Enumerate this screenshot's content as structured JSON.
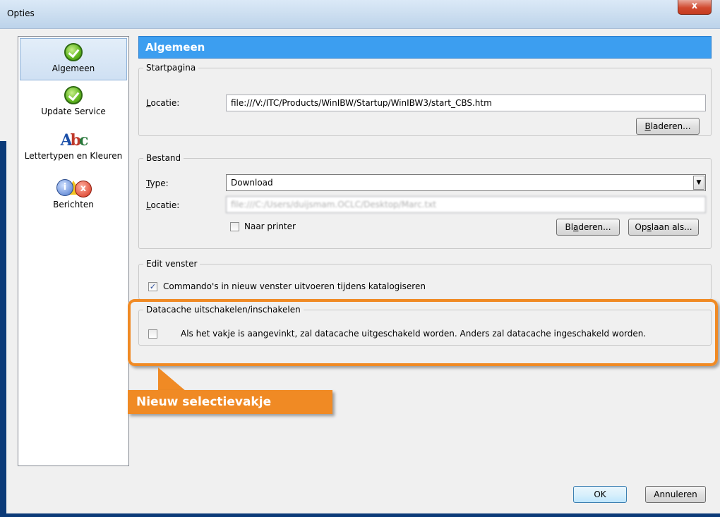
{
  "window": {
    "title": "Opties",
    "close_glyph": "x"
  },
  "sidebar": {
    "items": [
      {
        "label": "Algemeen",
        "icon": "check-icon",
        "selected": true
      },
      {
        "label": "Update Service",
        "icon": "check-icon",
        "selected": false
      },
      {
        "label": "Lettertypen en Kleuren",
        "icon": "abc-icon",
        "selected": false
      },
      {
        "label": "Berichten",
        "icon": "messages-icon",
        "selected": false
      }
    ]
  },
  "main": {
    "header": "Algemeen",
    "startpagina": {
      "legend": "Startpagina",
      "locatie_label_u": "L",
      "locatie_label_rest": "ocatie:",
      "locatie_value": "file:///V:/ITC/Products/WinIBW/Startup/WinIBW3/start_CBS.htm",
      "browse_u": "B",
      "browse_rest": "laderen..."
    },
    "bestand": {
      "legend": "Bestand",
      "type_label_u": "T",
      "type_label_rest": "ype:",
      "type_value": "Download",
      "locatie_label_u": "L",
      "locatie_label_rest": "ocatie:",
      "locatie_value": "file:///C:/Users/duijsmam.OCLC/Desktop/Marc.txt",
      "printer_label": "Naar printer",
      "printer_checked": false,
      "browse_pre": "Bl",
      "browse_u": "a",
      "browse_rest": "deren...",
      "saveas_pre": "Op",
      "saveas_u": "s",
      "saveas_rest": "laan als..."
    },
    "edit": {
      "legend": "Edit venster",
      "checkbox_label": "Commando's in nieuw venster uitvoeren tijdens katalogiseren",
      "checked": true,
      "check_glyph": "✓"
    },
    "datacache": {
      "legend": "Datacache uitschakelen/inschakelen",
      "checkbox_label": "Als het vakje is aangevinkt, zal datacache uitgeschakeld worden. Anders zal datacache ingeschakeld worden.",
      "checked": false
    }
  },
  "callout": {
    "text": "Nieuw selectievakje",
    "color": "#f08a24"
  },
  "footer": {
    "ok_label": "OK",
    "cancel_label": "Annuleren"
  },
  "colors": {
    "header_bg": "#3c9ef0",
    "highlight": "#f08a24"
  }
}
